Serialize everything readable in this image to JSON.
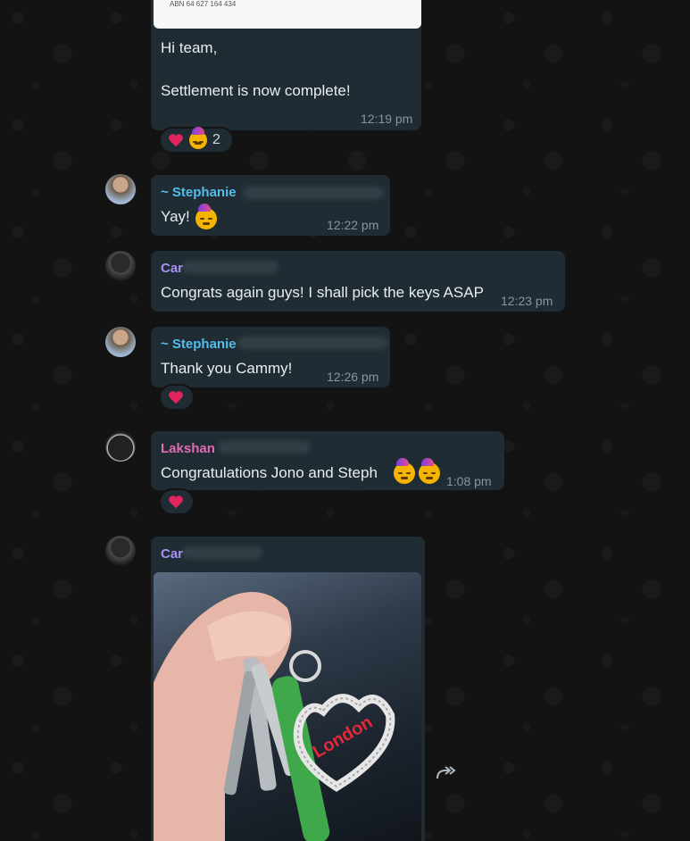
{
  "document": {
    "abn": "ABN 64 627 164 434"
  },
  "messages": [
    {
      "lines": [
        "Hi team,",
        "Settlement is now complete!"
      ],
      "time": "12:19 pm",
      "reaction_count": "2"
    },
    {
      "sender": "~ Stephanie",
      "text": "Yay!",
      "time": "12:22 pm"
    },
    {
      "sender": "Car",
      "text": "Congrats again guys! I shall pick the keys ASAP",
      "time": "12:23 pm"
    },
    {
      "sender": "~ Stephanie",
      "text": "Thank you Cammy!",
      "time": "12:26 pm"
    },
    {
      "sender": "Lakshan",
      "text": "Congratulations Jono and Steph",
      "time": "1:08 pm"
    },
    {
      "sender": "Car",
      "photo_caption": "London"
    }
  ],
  "colors": {
    "bubble": "#202c33",
    "sender_blue": "#53bdeb",
    "sender_purple": "#a791f2",
    "sender_pink": "#e26ab6",
    "heart": "#e0245e"
  },
  "icons": [
    "heart-icon",
    "party-face-emoji",
    "forward-icon"
  ]
}
